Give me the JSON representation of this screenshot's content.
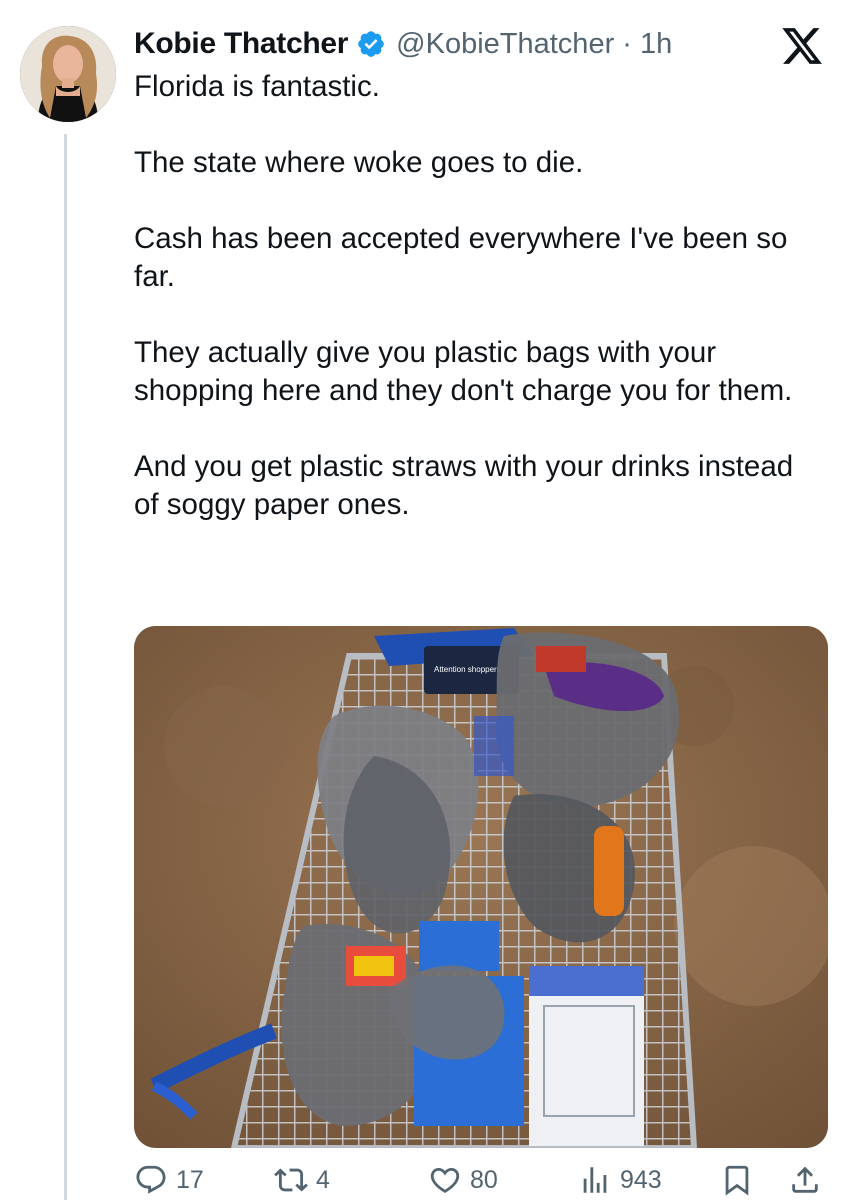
{
  "tweet": {
    "author": {
      "display_name": "Kobie Thatcher",
      "handle_meta": "@KobieThatcher · 1h",
      "verified": true
    },
    "paragraphs": [
      "Florida is fantastic.",
      "The state where woke goes to die.",
      "Cash has been accepted everywhere I've been so far.",
      "They actually give you plastic bags with your shopping here and they don't charge you for them.",
      "And you get plastic straws with your drinks instead of soggy paper ones."
    ],
    "media": {
      "type": "photo",
      "cart_sign_text": "Attention shoppers"
    }
  },
  "actions": {
    "replies": "17",
    "reposts": "4",
    "likes": "80",
    "views": "943"
  },
  "colors": {
    "text": "#0f1419",
    "muted": "#536471",
    "verified": "#1d9bf0",
    "thread_line": "#cfd9de"
  },
  "icons": [
    "x-logo-icon",
    "verified-badge-icon",
    "reply-icon",
    "repost-icon",
    "like-icon",
    "views-icon",
    "bookmark-icon",
    "share-icon"
  ]
}
